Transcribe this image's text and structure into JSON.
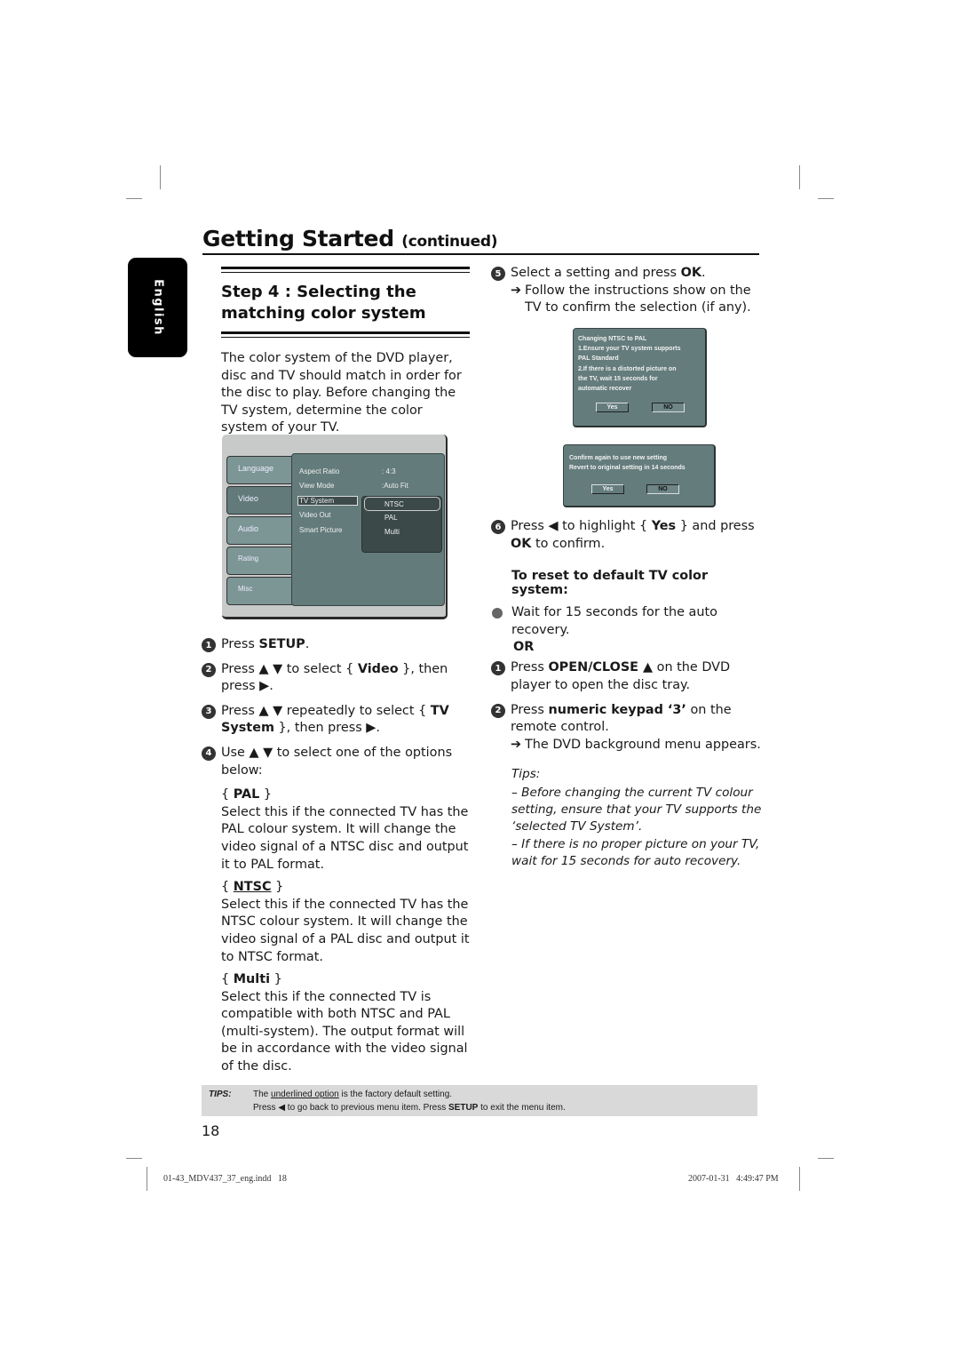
{
  "header": {
    "title": "Getting Started",
    "title_suffix": "(continued)",
    "language_tab": "English"
  },
  "left": {
    "step_title_line1": "Step 4 : Selecting the",
    "step_title_line2": "matching color system",
    "intro": "The color system of the DVD player, disc and TV should match in order for the disc to play. Before changing the TV system, determine the color system of your TV.",
    "dvd_menu": {
      "tabs": [
        "Language",
        "Video",
        "Audio",
        "Rating",
        "Misc"
      ],
      "active_tab": "Video",
      "rows": [
        {
          "label": "Aspect Ratio",
          "value": ": 4:3"
        },
        {
          "label": "View Mode",
          "value": ":Auto Fit"
        },
        {
          "label": "TV System",
          "value": ""
        },
        {
          "label": "Video Out",
          "value": ""
        },
        {
          "label": "Smart Picture",
          "value": ""
        }
      ],
      "dropdown": [
        "NTSC",
        "PAL",
        "Multi"
      ],
      "dropdown_selected": "NTSC"
    },
    "steps": [
      {
        "num": "1",
        "pre": "Press ",
        "bold": "SETUP",
        "post": "."
      },
      {
        "num": "2",
        "text": "Press ▲ ▼ to select { ",
        "bold": "Video",
        "post": " }, then press ▶."
      },
      {
        "num": "3",
        "text": "Press ▲ ▼ repeatedly to select { ",
        "bold": "TV System",
        "post": " }, then press ▶."
      },
      {
        "num": "4",
        "text": "Use ▲ ▼ to select one of the options below:"
      }
    ],
    "options": [
      {
        "name": "PAL",
        "desc": "Select this if the connected TV has the PAL colour system. It will change the video signal of a NTSC disc and output it to PAL format."
      },
      {
        "name": "NTSC",
        "desc": "Select this if the connected TV has the NTSC colour system. It will change the video signal of a PAL disc and output it to NTSC format.",
        "default": true
      },
      {
        "name": "Multi",
        "desc": "Select this if the connected TV is compatible with both NTSC and PAL (multi-system). The output format will be in accordance with the video signal of the disc."
      }
    ]
  },
  "right": {
    "step5": {
      "num": "5",
      "pre": "Select a setting and press ",
      "bold": "OK",
      "post": ".",
      "result": "Follow the instructions show on the TV to confirm the selection (if any)."
    },
    "osd1": {
      "lines": [
        "Changing NTSC to PAL",
        "1.Ensure your TV system supports",
        "PAL Standard",
        "2.If there is a distorted picture on",
        "the TV, wait 15 seconds for",
        "automatic recover"
      ],
      "yes": "Yes",
      "no": "NO"
    },
    "osd2": {
      "lines": [
        "Confirm again to use new setting",
        "Revert to original setting in 14 seconds"
      ],
      "yes": "Yes",
      "no": "NO"
    },
    "step6": {
      "num": "6",
      "pre": "Press ◀ to highlight { ",
      "bold": "Yes",
      "mid": " } and press ",
      "bold2": "OK",
      "post": " to confirm."
    },
    "reset_title": "To reset to default TV color system:",
    "bullet": "Wait for 15 seconds for the auto recovery.",
    "or": "OR",
    "reset_steps": [
      {
        "num": "1",
        "pre": "Press ",
        "bold": "OPEN/CLOSE ▲",
        "post": " on the DVD player to open the disc tray."
      },
      {
        "num": "2",
        "pre": "Press ",
        "bold": "numeric keypad ‘3’",
        "post": " on the remote control.",
        "result": "The DVD background menu appears."
      }
    ],
    "tips_label": "Tips:",
    "tips": [
      "– Before changing the current TV colour setting, ensure that your TV supports the ‘selected TV System’.",
      "– If there is no proper picture on your TV, wait for 15 seconds for auto recovery."
    ]
  },
  "footer_tips": {
    "label": "TIPS:",
    "line1_pre": "The ",
    "line1_u": "underlined option",
    "line1_post": " is the factory default setting.",
    "line2_pre": "Press ◀ to go back to previous menu item. Press ",
    "line2_bold": "SETUP",
    "line2_post": " to exit the menu item."
  },
  "page_number": "18",
  "slug": {
    "file": "01-43_MDV437_37_eng.indd   18",
    "date": "2007-01-31   4:49:47 PM"
  }
}
